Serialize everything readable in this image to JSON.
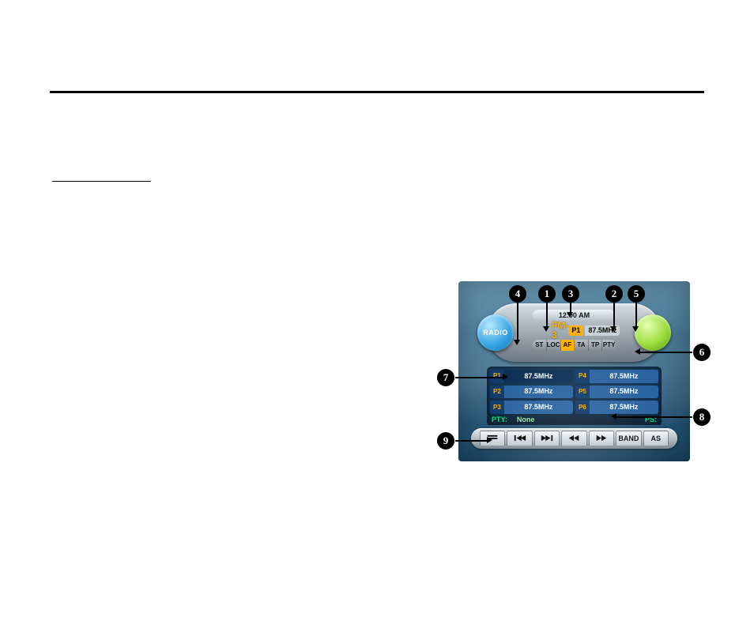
{
  "illus": {
    "radio_label": "RADIO",
    "clock": "12:00 AM",
    "band": "FM-3",
    "current": {
      "preset": "P1",
      "freq": "87.5MHz"
    },
    "flags": [
      "ST",
      "LOC",
      "AF",
      "TA",
      "TP",
      "PTY"
    ],
    "flags_active": [
      2
    ],
    "presets": [
      {
        "n": "P1",
        "f": "87.5MHz"
      },
      {
        "n": "P2",
        "f": "87.5MHz"
      },
      {
        "n": "P3",
        "f": "87.5MHz"
      },
      {
        "n": "P4",
        "f": "87.5MHz"
      },
      {
        "n": "P5",
        "f": "87.5MHz"
      },
      {
        "n": "P6",
        "f": "87.5MHz"
      }
    ],
    "pty": {
      "key": "PTY:",
      "val": "None",
      "ps": "PS:"
    },
    "controls": {
      "band": "BAND",
      "as": "AS"
    }
  },
  "callouts": {
    "1": "1",
    "2": "2",
    "3": "3",
    "4": "4",
    "5": "5",
    "6": "6",
    "7": "7",
    "8": "8",
    "9": "9"
  }
}
